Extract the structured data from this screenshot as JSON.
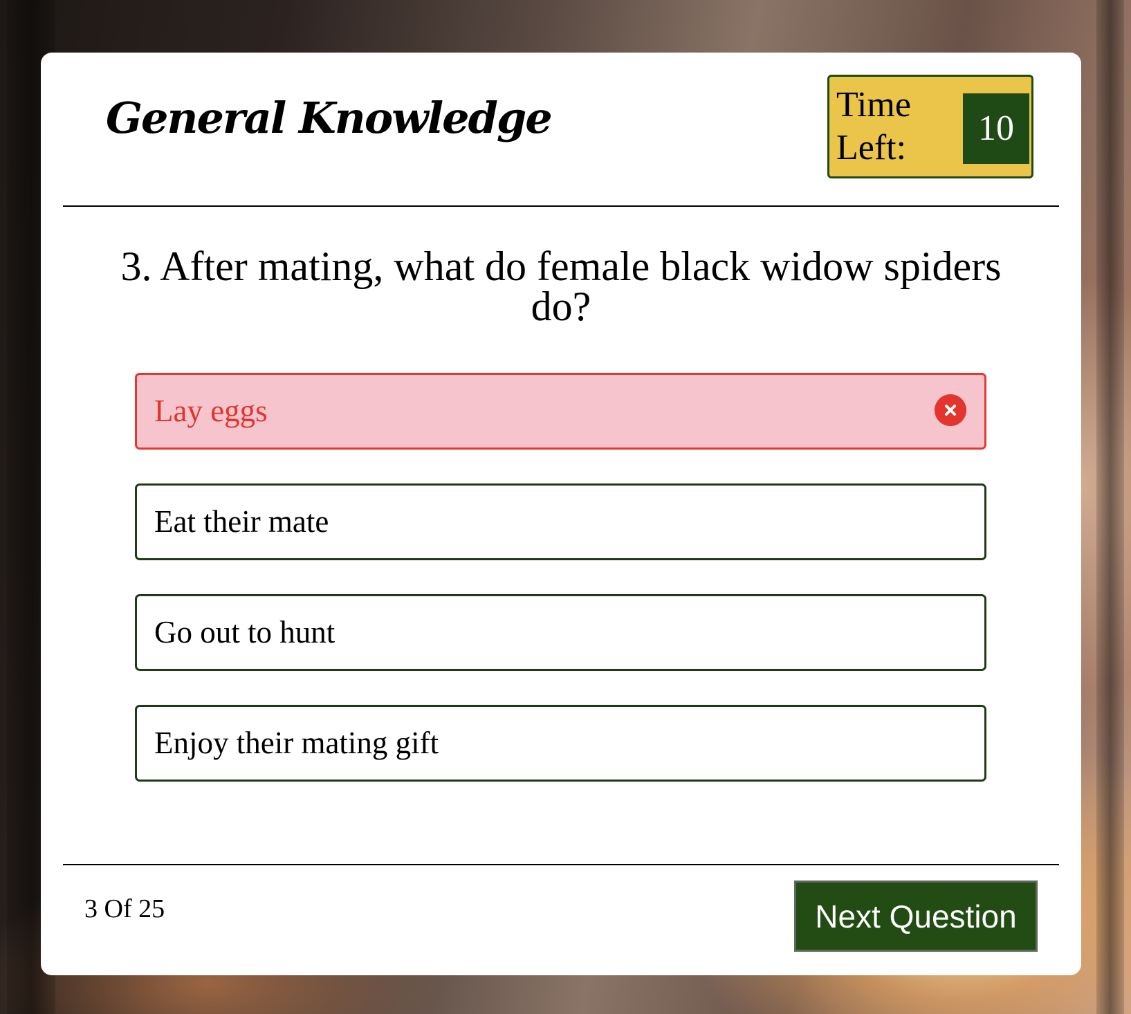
{
  "quiz": {
    "title": "General Knowledge",
    "timer": {
      "label": "Time Left:",
      "value": "10"
    },
    "question": {
      "text": "3. After mating, what do female black widow spiders do?"
    },
    "options": [
      {
        "label": "Lay eggs",
        "state": "wrong",
        "icon": "close-icon"
      },
      {
        "label": "Eat their mate",
        "state": "neutral"
      },
      {
        "label": "Go out to hunt",
        "state": "neutral"
      },
      {
        "label": "Enjoy their mating gift",
        "state": "neutral"
      }
    ],
    "footer": {
      "progress": "3 Of 25",
      "next_label": "Next Question"
    }
  },
  "colors": {
    "accent_green": "#1f4a15",
    "timer_yellow": "#eac54a",
    "wrong_red": "#e53830",
    "wrong_bg": "#f5c4cc"
  }
}
